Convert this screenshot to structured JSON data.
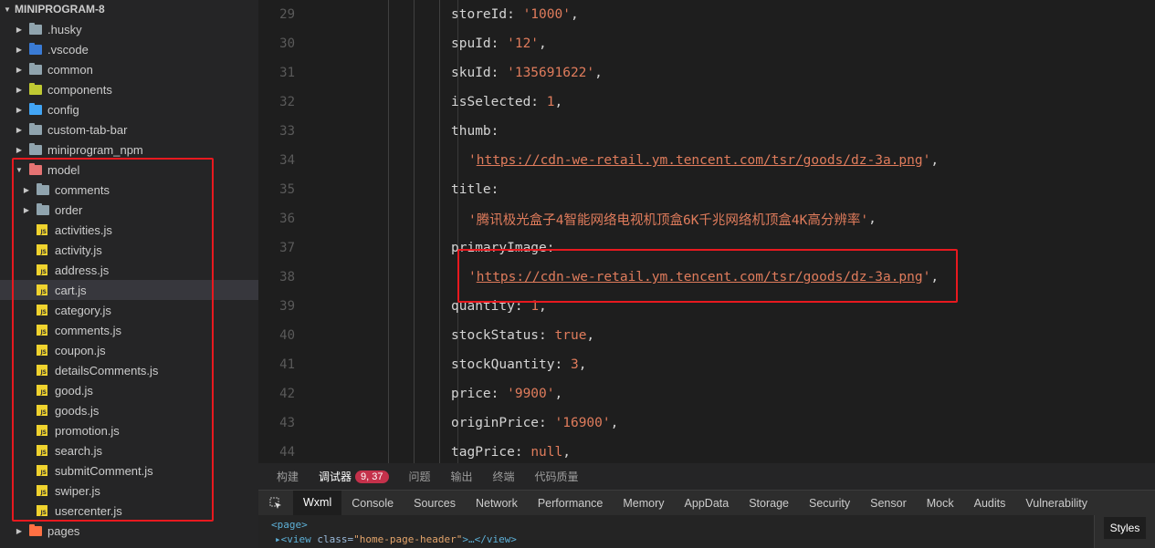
{
  "explorer": {
    "root": "MINIPROGRAM-8",
    "items": [
      {
        "label": ".husky",
        "kind": "folder",
        "icon": "folder-icon",
        "color": "grey"
      },
      {
        "label": ".vscode",
        "kind": "folder",
        "icon": "vscode-folder-icon",
        "color": "blue"
      },
      {
        "label": "common",
        "kind": "folder",
        "icon": "folder-icon",
        "color": "grey"
      },
      {
        "label": "components",
        "kind": "folder",
        "icon": "components-folder-icon",
        "color": "yellow-green"
      },
      {
        "label": "config",
        "kind": "folder",
        "icon": "config-folder-icon",
        "color": "blue"
      },
      {
        "label": "custom-tab-bar",
        "kind": "folder",
        "icon": "folder-icon",
        "color": "grey"
      },
      {
        "label": "miniprogram_npm",
        "kind": "folder",
        "icon": "folder-icon",
        "color": "grey"
      },
      {
        "label": "model",
        "kind": "folder-open",
        "icon": "model-folder-icon",
        "color": "red"
      },
      {
        "label": "comments",
        "kind": "folder",
        "icon": "folder-icon",
        "color": "grey"
      },
      {
        "label": "order",
        "kind": "folder",
        "icon": "folder-icon",
        "color": "grey"
      },
      {
        "label": "activities.js",
        "kind": "file",
        "icon": "js-file-icon"
      },
      {
        "label": "activity.js",
        "kind": "file",
        "icon": "js-file-icon"
      },
      {
        "label": "address.js",
        "kind": "file",
        "icon": "js-file-icon"
      },
      {
        "label": "cart.js",
        "kind": "file",
        "icon": "js-file-icon",
        "selected": true
      },
      {
        "label": "category.js",
        "kind": "file",
        "icon": "js-file-icon"
      },
      {
        "label": "comments.js",
        "kind": "file",
        "icon": "js-file-icon"
      },
      {
        "label": "coupon.js",
        "kind": "file",
        "icon": "js-file-icon"
      },
      {
        "label": "detailsComments.js",
        "kind": "file",
        "icon": "js-file-icon"
      },
      {
        "label": "good.js",
        "kind": "file",
        "icon": "js-file-icon"
      },
      {
        "label": "goods.js",
        "kind": "file",
        "icon": "js-file-icon"
      },
      {
        "label": "promotion.js",
        "kind": "file",
        "icon": "js-file-icon"
      },
      {
        "label": "search.js",
        "kind": "file",
        "icon": "js-file-icon"
      },
      {
        "label": "submitComment.js",
        "kind": "file",
        "icon": "js-file-icon"
      },
      {
        "label": "swiper.js",
        "kind": "file",
        "icon": "js-file-icon"
      },
      {
        "label": "usercenter.js",
        "kind": "file",
        "icon": "js-file-icon"
      },
      {
        "label": "pages",
        "kind": "folder",
        "icon": "pages-folder-icon",
        "color": "orange"
      }
    ],
    "js_badge": "JS"
  },
  "editor": {
    "lines": [
      {
        "num": "29",
        "parts": [
          {
            "t": "storeId: ",
            "c": "key"
          },
          {
            "t": "'1000'",
            "c": "str"
          },
          {
            "t": ",",
            "c": "key"
          }
        ]
      },
      {
        "num": "30",
        "parts": [
          {
            "t": "spuId: ",
            "c": "key"
          },
          {
            "t": "'12'",
            "c": "str"
          },
          {
            "t": ",",
            "c": "key"
          }
        ]
      },
      {
        "num": "31",
        "parts": [
          {
            "t": "skuId: ",
            "c": "key"
          },
          {
            "t": "'135691622'",
            "c": "str"
          },
          {
            "t": ",",
            "c": "key"
          }
        ]
      },
      {
        "num": "32",
        "parts": [
          {
            "t": "isSelected: ",
            "c": "key"
          },
          {
            "t": "1",
            "c": "num"
          },
          {
            "t": ",",
            "c": "key"
          }
        ]
      },
      {
        "num": "33",
        "parts": [
          {
            "t": "thumb:",
            "c": "key"
          }
        ]
      },
      {
        "num": "34",
        "indent": true,
        "parts": [
          {
            "t": "'",
            "c": "str"
          },
          {
            "t": "https://cdn-we-retail.ym.tencent.com/tsr/goods/dz-3a.png",
            "c": "link"
          },
          {
            "t": "'",
            "c": "str"
          },
          {
            "t": ",",
            "c": "key"
          }
        ]
      },
      {
        "num": "35",
        "parts": [
          {
            "t": "title:",
            "c": "key"
          }
        ]
      },
      {
        "num": "36",
        "indent": true,
        "parts": [
          {
            "t": "'腾讯极光盒子4智能网络电视机顶盒6K千兆网络机顶盒4K高分辨率'",
            "c": "str"
          },
          {
            "t": ",",
            "c": "key"
          }
        ]
      },
      {
        "num": "37",
        "parts": [
          {
            "t": "primaryImage:",
            "c": "key"
          }
        ]
      },
      {
        "num": "38",
        "indent": true,
        "parts": [
          {
            "t": "'",
            "c": "str"
          },
          {
            "t": "https://cdn-we-retail.ym.tencent.com/tsr/goods/dz-3a.png",
            "c": "link"
          },
          {
            "t": "'",
            "c": "str"
          },
          {
            "t": ",",
            "c": "key"
          }
        ]
      },
      {
        "num": "39",
        "parts": [
          {
            "t": "quantity: ",
            "c": "key"
          },
          {
            "t": "1",
            "c": "num"
          },
          {
            "t": ",",
            "c": "key"
          }
        ]
      },
      {
        "num": "40",
        "parts": [
          {
            "t": "stockStatus: ",
            "c": "key"
          },
          {
            "t": "true",
            "c": "lit"
          },
          {
            "t": ",",
            "c": "key"
          }
        ]
      },
      {
        "num": "41",
        "parts": [
          {
            "t": "stockQuantity: ",
            "c": "key"
          },
          {
            "t": "3",
            "c": "num"
          },
          {
            "t": ",",
            "c": "key"
          }
        ]
      },
      {
        "num": "42",
        "parts": [
          {
            "t": "price: ",
            "c": "key"
          },
          {
            "t": "'9900'",
            "c": "str"
          },
          {
            "t": ",",
            "c": "key"
          }
        ]
      },
      {
        "num": "43",
        "parts": [
          {
            "t": "originPrice: ",
            "c": "key"
          },
          {
            "t": "'16900'",
            "c": "str"
          },
          {
            "t": ",",
            "c": "key"
          }
        ]
      },
      {
        "num": "44",
        "parts": [
          {
            "t": "tagPrice: ",
            "c": "key"
          },
          {
            "t": "null",
            "c": "lit"
          },
          {
            "t": ",",
            "c": "key"
          }
        ]
      }
    ]
  },
  "panel": {
    "tabs": [
      {
        "label": "构建"
      },
      {
        "label": "调试器",
        "active": true,
        "badge": "9, 37"
      },
      {
        "label": "问题"
      },
      {
        "label": "输出"
      },
      {
        "label": "终端"
      },
      {
        "label": "代码质量"
      }
    ]
  },
  "devtools": {
    "tabs": [
      "Wxml",
      "Console",
      "Sources",
      "Network",
      "Performance",
      "Memory",
      "AppData",
      "Storage",
      "Security",
      "Sensor",
      "Mock",
      "Audits",
      "Vulnerability"
    ],
    "active_tab": "Wxml",
    "wxml_line1": "<page>",
    "wxml_line2_tag_open": "▸<view ",
    "wxml_line2_attr": "class=",
    "wxml_line2_val": "\"home-page-header\"",
    "wxml_line2_rest": ">…</view>",
    "styles_tab": "Styles"
  },
  "colors": {
    "highlight_box": "#e8191f",
    "string": "#e07c5c",
    "sidebar_bg": "#252526",
    "editor_bg": "#1e1e1e"
  }
}
